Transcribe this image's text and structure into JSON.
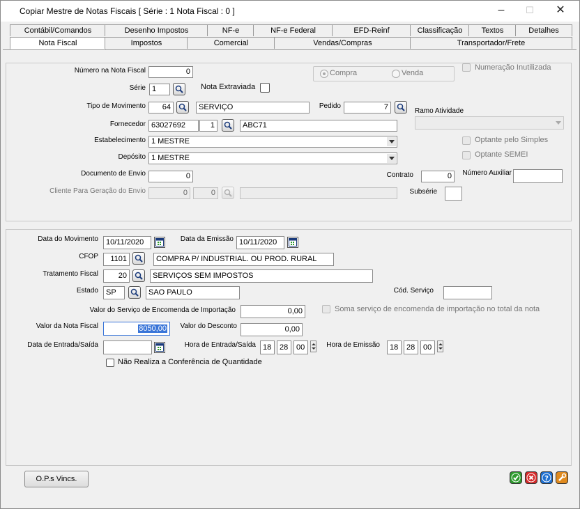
{
  "window": {
    "title": "Copiar Mestre de Notas Fiscais [ Série : 1 Nota Fiscal : 0 ]"
  },
  "tabs_row1": [
    "Contábil/Comandos",
    "Desenho Impostos",
    "NF-e",
    "NF-e Federal",
    "EFD-Reinf",
    "Classificação",
    "Textos",
    "Detalhes"
  ],
  "tabs_row2": [
    "Nota Fiscal",
    "Impostos",
    "Comercial",
    "Vendas/Compras",
    "Transportador/Frete"
  ],
  "active_tab": "Nota Fiscal",
  "top": {
    "numero_label": "Número na Nota Fiscal",
    "numero_value": "0",
    "serie_label": "Série",
    "serie_value": "1",
    "extraviada_label": "Nota Extraviada",
    "tipo_mov_label": "Tipo de Movimento",
    "tipo_mov_code": "64",
    "tipo_mov_desc": "SERVIÇO",
    "pedido_label": "Pedido",
    "pedido_value": "7",
    "fornecedor_label": "Fornecedor",
    "fornecedor_code": "63027692",
    "fornecedor_seq": "1",
    "fornecedor_name": "ABC71",
    "estab_label": "Estabelecimento",
    "estab_value": "1 MESTRE",
    "deposito_label": "Depósito",
    "deposito_value": "1 MESTRE",
    "doc_envio_label": "Documento de Envio",
    "doc_envio_value": "0",
    "contrato_label": "Contrato",
    "contrato_value": "0",
    "num_aux_label": "Número Auxiliar",
    "num_aux_value": "",
    "cliente_label": "Cliente Para Geração do Envio",
    "cliente_code": "0",
    "cliente_seq": "0",
    "subserie_label": "Subsérie",
    "subserie_value": "",
    "radio_compra": "Compra",
    "radio_venda": "Venda",
    "radio_selected": "Compra",
    "num_inutilizada_label": "Numeração Inutilizada",
    "ramo_label": "Ramo Atividade",
    "ramo_value": "",
    "simples_label": "Optante pelo Simples",
    "semei_label": "Optante SEMEI"
  },
  "bottom": {
    "data_mov_label": "Data do Movimento",
    "data_mov_value": "10/11/2020",
    "data_emissao_label": "Data da Emissão",
    "data_emissao_value": "10/11/2020",
    "cfop_label": "CFOP",
    "cfop_code": "1101",
    "cfop_desc": "COMPRA P/ INDUSTRIAL. OU PROD. RURAL",
    "trat_label": "Tratamento Fiscal",
    "trat_code": "20",
    "trat_desc": "SERVIÇOS SEM IMPOSTOS",
    "estado_label": "Estado",
    "estado_code": "SP",
    "estado_desc": "SAO PAULO",
    "cod_servico_label": "Cód. Serviço",
    "cod_servico_value": "",
    "valor_enc_label": "Valor do Serviço de Encomenda de Importação",
    "valor_enc_value": "0,00",
    "soma_label": "Soma serviço de encomenda de importação no total da nota",
    "valor_nota_label": "Valor da Nota Fiscal",
    "valor_nota_value": "8050,00",
    "valor_desc_label": "Valor do Desconto",
    "valor_desc_value": "0,00",
    "data_entrada_label": "Data de Entrada/Saída",
    "data_entrada_value": "",
    "hora_entrada_label": "Hora de Entrada/Saída",
    "hora_entrada_h": "18",
    "hora_entrada_m": "28",
    "hora_entrada_s": "00",
    "hora_emissao_label": "Hora de Emissão",
    "hora_emissao_h": "18",
    "hora_emissao_m": "28",
    "hora_emissao_s": "00",
    "conferencia_label": "Não Realiza a Conferência de Quantidade"
  },
  "footer": {
    "ops_label": "O.P.s Vincs."
  },
  "colors": {
    "ok": "#2e9b2e",
    "cancel": "#d42a2a",
    "help": "#1e6fd0",
    "tool": "#e08a1e",
    "selection": "#3874d8"
  }
}
